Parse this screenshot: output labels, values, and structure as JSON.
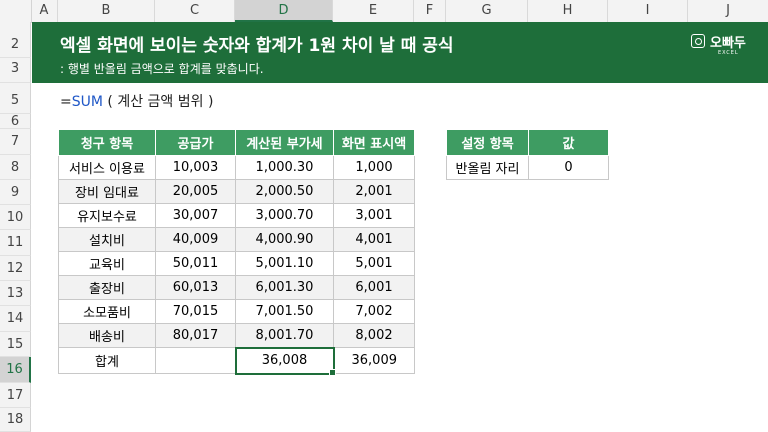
{
  "columns": [
    "A",
    "B",
    "C",
    "D",
    "E",
    "F",
    "G",
    "H",
    "I",
    "J"
  ],
  "rows": [
    "2",
    "3",
    "5",
    "6",
    "7",
    "8",
    "9",
    "10",
    "11",
    "12",
    "13",
    "14",
    "15",
    "16",
    "17",
    "18"
  ],
  "banner": {
    "title": "엑셀 화면에 보이는 숫자와 합계가 1원 차이 날 때 공식",
    "subtitle": ": 행별 반올림 금액으로 합계를 맞춥니다.",
    "logo_text": "오빠두",
    "logo_sub": "EXCEL"
  },
  "formula": {
    "prefix": "=",
    "fn": "SUM",
    "args": " ( 계산 금액 범위 )"
  },
  "main_table": {
    "headers": [
      "청구 항목",
      "공급가",
      "계산된 부가세",
      "화면 표시액"
    ],
    "rows": [
      [
        "서비스 이용료",
        "10,003",
        "1,000.30",
        "1,000"
      ],
      [
        "장비 임대료",
        "20,005",
        "2,000.50",
        "2,001"
      ],
      [
        "유지보수료",
        "30,007",
        "3,000.70",
        "3,001"
      ],
      [
        "설치비",
        "40,009",
        "4,000.90",
        "4,001"
      ],
      [
        "교육비",
        "50,011",
        "5,001.10",
        "5,001"
      ],
      [
        "출장비",
        "60,013",
        "6,001.30",
        "6,001"
      ],
      [
        "소모품비",
        "70,015",
        "7,001.50",
        "7,002"
      ],
      [
        "배송비",
        "80,017",
        "8,001.70",
        "8,002"
      ]
    ],
    "total": [
      "합계",
      "",
      "36,008",
      "36,009"
    ]
  },
  "settings_table": {
    "headers": [
      "설정 항목",
      "값"
    ],
    "rows": [
      [
        "반올림 자리",
        "0"
      ]
    ]
  },
  "colors": {
    "banner": "#1e6e3a",
    "header": "#3e9c62",
    "accent": "#217346"
  }
}
